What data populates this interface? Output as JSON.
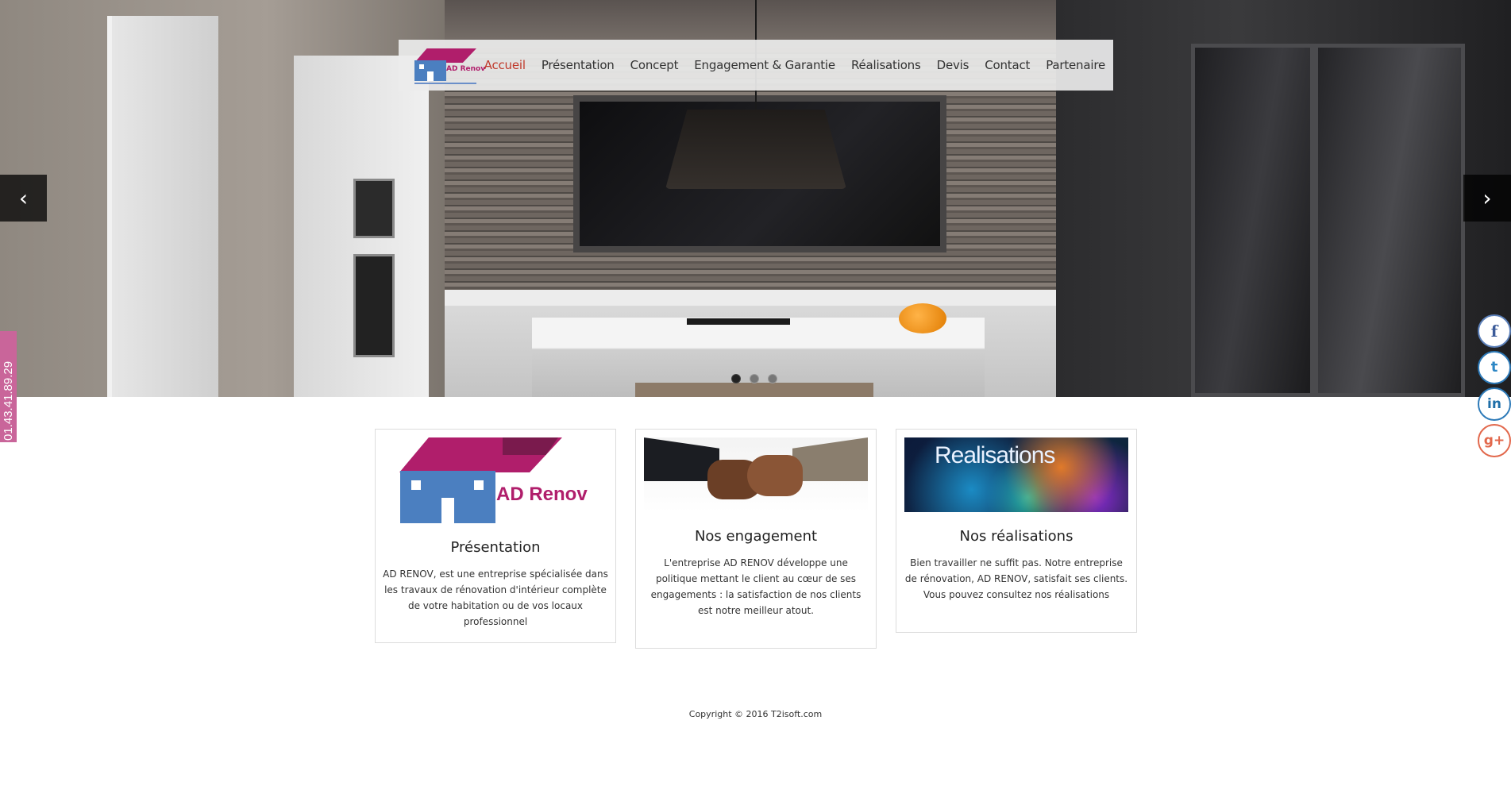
{
  "nav": {
    "logo_text": "AD Renov",
    "items": [
      {
        "label": "Accueil"
      },
      {
        "label": "Présentation"
      },
      {
        "label": "Concept"
      },
      {
        "label": "Engagement & Garantie"
      },
      {
        "label": "Réalisations"
      },
      {
        "label": "Devis"
      },
      {
        "label": "Contact"
      },
      {
        "label": "Partenaire"
      }
    ],
    "active_item": "Accueil",
    "active_color": "#c0392b"
  },
  "hero": {
    "prev_icon": "chevron-left-icon",
    "next_icon": "chevron-right-icon",
    "prev_glyph": "‹",
    "next_glyph": "›",
    "slide_count": 3,
    "active_slide": 1
  },
  "phone_tab": {
    "number": "01.43.41.89.29",
    "color": "#c9659a"
  },
  "social": [
    {
      "name": "facebook-icon",
      "glyph": "f"
    },
    {
      "name": "twitter-icon",
      "glyph": "t"
    },
    {
      "name": "linkedin-icon",
      "glyph": "in"
    },
    {
      "name": "google-plus-icon",
      "glyph": "g+"
    }
  ],
  "cards": [
    {
      "image_text": "AD Renov",
      "title": "Présentation",
      "text": "AD RENOV, est une entreprise spécialisée dans les travaux de rénovation d'intérieur complète de votre habitation ou de vos locaux professionnel"
    },
    {
      "title": "Nos engagement",
      "text": "L'entreprise AD RENOV développe une politique mettant le client au cœur de ses engagements : la satisfaction de nos clients est notre meilleur atout."
    },
    {
      "image_text": "Realisations",
      "title": "Nos réalisations",
      "text": "Bien travailler ne suffit pas. Notre entreprise de rénovation, AD RENOV, satisfait ses clients. Vous pouvez consultez nos réalisations"
    }
  ],
  "footer": {
    "copyright": "Copyright © 2016 T2isoft.com"
  },
  "colors": {
    "brand_magenta": "#b01e6b",
    "brand_blue": "#4b7fc0"
  }
}
